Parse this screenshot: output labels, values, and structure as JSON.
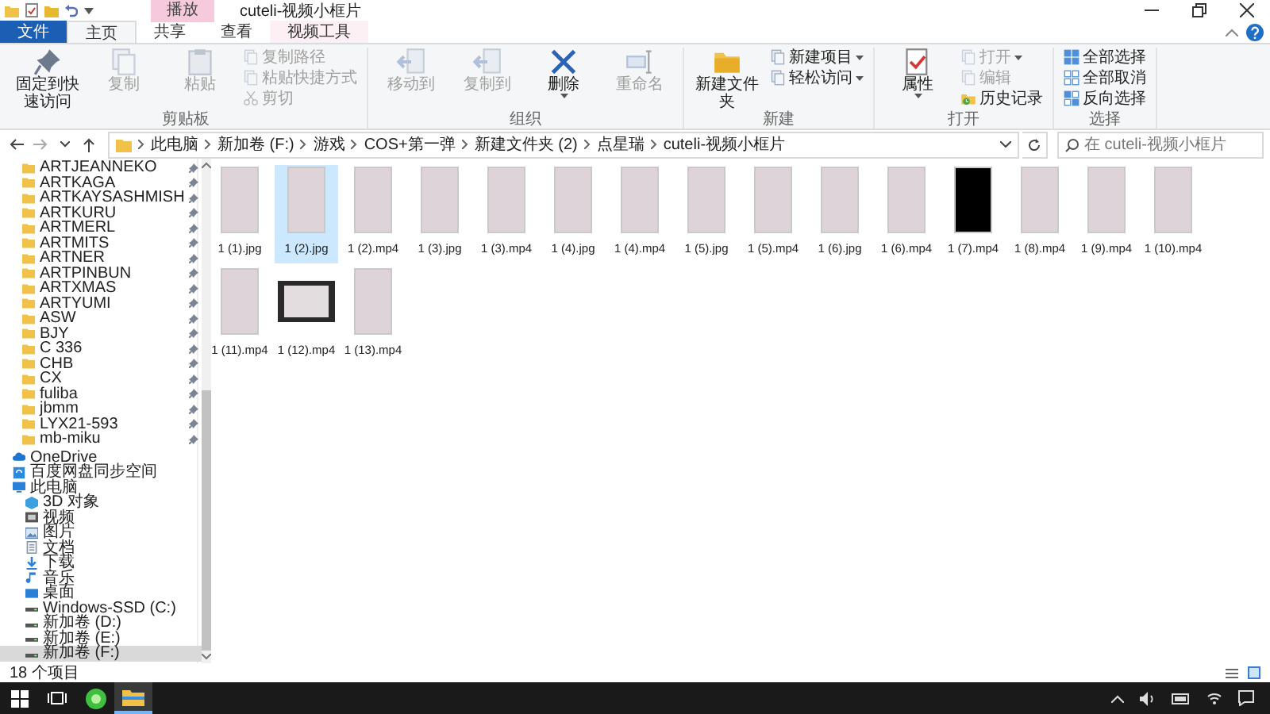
{
  "window": {
    "title": "cuteli-视频小框片",
    "context_tab": "播放"
  },
  "tabs": [
    {
      "label": "文件",
      "kind": "file",
      "selected": false
    },
    {
      "label": "主页",
      "kind": "normal",
      "selected": true
    },
    {
      "label": "共享",
      "kind": "normal",
      "selected": false
    },
    {
      "label": "查看",
      "kind": "normal",
      "selected": false
    },
    {
      "label": "视频工具",
      "kind": "context",
      "selected": false
    }
  ],
  "ribbon": {
    "groups": [
      {
        "label": "剪贴板",
        "columns": [
          [
            {
              "label": "固定到快速访问",
              "kind": "large",
              "disabled": false,
              "has_menu": false
            }
          ],
          [
            {
              "label": "复制",
              "kind": "large",
              "disabled": true,
              "has_menu": false
            }
          ],
          [
            {
              "label": "粘贴",
              "kind": "large",
              "disabled": true,
              "has_menu": false
            }
          ],
          [
            {
              "label": "复制路径",
              "kind": "small",
              "disabled": true,
              "has_menu": false
            },
            {
              "label": "粘贴快捷方式",
              "kind": "small",
              "disabled": true,
              "has_menu": false
            },
            {
              "label": "剪切",
              "kind": "small",
              "disabled": true,
              "has_menu": false
            }
          ]
        ]
      },
      {
        "label": "组织",
        "columns": [
          [
            {
              "label": "移动到",
              "kind": "large",
              "disabled": true,
              "has_menu": false
            }
          ],
          [
            {
              "label": "复制到",
              "kind": "large",
              "disabled": true,
              "has_menu": false
            }
          ],
          [
            {
              "label": "删除",
              "kind": "large",
              "disabled": false,
              "has_menu": true
            }
          ],
          [
            {
              "label": "重命名",
              "kind": "large",
              "disabled": true,
              "has_menu": false
            }
          ]
        ]
      },
      {
        "label": "新建",
        "columns": [
          [
            {
              "label": "新建文件夹",
              "kind": "large",
              "disabled": false,
              "has_menu": false
            }
          ],
          [
            {
              "label": "新建项目",
              "kind": "small",
              "disabled": false,
              "has_menu": true
            },
            {
              "label": "轻松访问",
              "kind": "small",
              "disabled": false,
              "has_menu": true
            }
          ]
        ]
      },
      {
        "label": "打开",
        "columns": [
          [
            {
              "label": "属性",
              "kind": "large",
              "disabled": false,
              "has_menu": true
            }
          ],
          [
            {
              "label": "打开",
              "kind": "small",
              "disabled": true,
              "has_menu": true
            },
            {
              "label": "编辑",
              "kind": "small",
              "disabled": true,
              "has_menu": false
            },
            {
              "label": "历史记录",
              "kind": "small",
              "disabled": false,
              "has_menu": false
            }
          ]
        ]
      },
      {
        "label": "选择",
        "columns": [
          [
            {
              "label": "全部选择",
              "kind": "small",
              "disabled": false,
              "has_menu": false
            },
            {
              "label": "全部取消",
              "kind": "small",
              "disabled": false,
              "has_menu": false
            },
            {
              "label": "反向选择",
              "kind": "small",
              "disabled": false,
              "has_menu": false
            }
          ]
        ]
      }
    ]
  },
  "address_bar": {
    "path": [
      "此电脑",
      "新加卷 (F:)",
      "游戏",
      "COS+第一弹",
      "新建文件夹 (2)",
      "点星瑞",
      "cuteli-视频小框片"
    ],
    "search": {
      "placeholder": "在 cuteli-视频小框片"
    }
  },
  "sidebar": {
    "items": [
      {
        "label": "ARTJEANNEKO",
        "kind": "folder",
        "pinned": true,
        "selected": false
      },
      {
        "label": "ARTKAGA",
        "kind": "folder",
        "pinned": true,
        "selected": false
      },
      {
        "label": "ARTKAYSASHMISH",
        "kind": "folder",
        "pinned": true,
        "selected": false
      },
      {
        "label": "ARTKURU",
        "kind": "folder",
        "pinned": true,
        "selected": false
      },
      {
        "label": "ARTMERL",
        "kind": "folder",
        "pinned": true,
        "selected": false
      },
      {
        "label": "ARTMITS",
        "kind": "folder",
        "pinned": true,
        "selected": false
      },
      {
        "label": "ARTNER",
        "kind": "folder",
        "pinned": true,
        "selected": false
      },
      {
        "label": "ARTPINBUN",
        "kind": "folder",
        "pinned": true,
        "selected": false
      },
      {
        "label": "ARTXMAS",
        "kind": "folder",
        "pinned": true,
        "selected": false
      },
      {
        "label": "ARTYUMI",
        "kind": "folder",
        "pinned": true,
        "selected": false
      },
      {
        "label": "ASW",
        "kind": "folder",
        "pinned": true,
        "selected": false
      },
      {
        "label": "BJY",
        "kind": "folder",
        "pinned": true,
        "selected": false
      },
      {
        "label": "C 336",
        "kind": "folder",
        "pinned": true,
        "selected": false
      },
      {
        "label": "CHB",
        "kind": "folder",
        "pinned": true,
        "selected": false
      },
      {
        "label": "CX",
        "kind": "folder",
        "pinned": true,
        "selected": false
      },
      {
        "label": "fuliba",
        "kind": "folder",
        "pinned": true,
        "selected": false
      },
      {
        "label": "jbmm",
        "kind": "folder",
        "pinned": true,
        "selected": false
      },
      {
        "label": "LYX21-593",
        "kind": "folder",
        "pinned": true,
        "selected": false
      },
      {
        "label": "mb-miku",
        "kind": "folder",
        "pinned": true,
        "selected": false
      },
      {
        "label": "OneDrive",
        "kind": "cloud",
        "pinned": false,
        "selected": false
      },
      {
        "label": "百度网盘同步空间",
        "kind": "sync",
        "pinned": false,
        "selected": false
      },
      {
        "label": "此电脑",
        "kind": "pc",
        "pinned": false,
        "selected": false,
        "children": [
          {
            "label": "3D 对象",
            "kind": "cube",
            "selected": false
          },
          {
            "label": "视频",
            "kind": "video",
            "selected": false
          },
          {
            "label": "图片",
            "kind": "picture",
            "selected": false
          },
          {
            "label": "文档",
            "kind": "document",
            "selected": false
          },
          {
            "label": "下载",
            "kind": "download",
            "selected": false
          },
          {
            "label": "音乐",
            "kind": "music",
            "selected": false
          },
          {
            "label": "桌面",
            "kind": "desktop",
            "selected": false
          },
          {
            "label": "Windows-SSD (C:)",
            "kind": "drive",
            "selected": false
          },
          {
            "label": "新加卷 (D:)",
            "kind": "drive",
            "selected": false
          },
          {
            "label": "新加卷 (E:)",
            "kind": "drive",
            "selected": false
          },
          {
            "label": "新加卷 (F:)",
            "kind": "drive",
            "selected": true
          }
        ]
      }
    ]
  },
  "files": [
    {
      "name": "1 (1).jpg",
      "kind": "portrait",
      "selected": false
    },
    {
      "name": "1 (2).jpg",
      "kind": "portrait",
      "selected": true
    },
    {
      "name": "1 (2).mp4",
      "kind": "portrait",
      "selected": false
    },
    {
      "name": "1 (3).jpg",
      "kind": "portrait",
      "selected": false
    },
    {
      "name": "1 (3).mp4",
      "kind": "portrait",
      "selected": false
    },
    {
      "name": "1 (4).jpg",
      "kind": "portrait",
      "selected": false
    },
    {
      "name": "1 (4).mp4",
      "kind": "portrait",
      "selected": false
    },
    {
      "name": "1 (5).jpg",
      "kind": "portrait",
      "selected": false
    },
    {
      "name": "1 (5).mp4",
      "kind": "portrait",
      "selected": false
    },
    {
      "name": "1 (6).jpg",
      "kind": "portrait",
      "selected": false
    },
    {
      "name": "1 (6).mp4",
      "kind": "portrait",
      "selected": false
    },
    {
      "name": "1 (7).mp4",
      "kind": "dark",
      "selected": false
    },
    {
      "name": "1 (8).mp4",
      "kind": "portrait",
      "selected": false
    },
    {
      "name": "1 (9).mp4",
      "kind": "portrait",
      "selected": false
    },
    {
      "name": "1 (10).mp4",
      "kind": "portrait",
      "selected": false
    },
    {
      "name": "1 (11).mp4",
      "kind": "portrait",
      "selected": false
    },
    {
      "name": "1 (12).mp4",
      "kind": "film",
      "selected": false
    },
    {
      "name": "1 (13).mp4",
      "kind": "portrait",
      "selected": false
    }
  ],
  "status_bar": {
    "count": "18 个项目"
  }
}
